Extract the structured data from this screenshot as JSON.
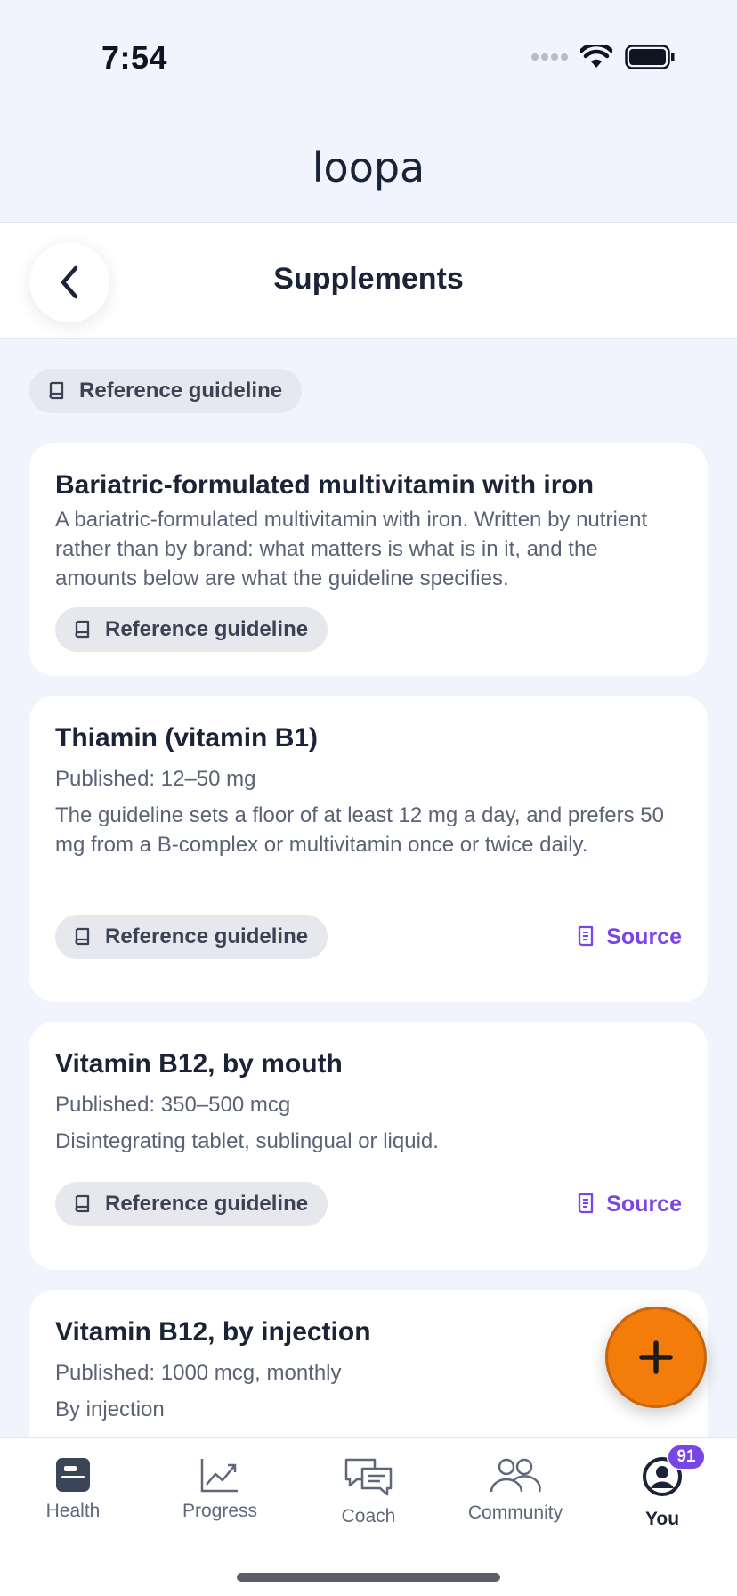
{
  "status": {
    "time": "7:54"
  },
  "app": {
    "logo": "loopa"
  },
  "header": {
    "title": "Supplements",
    "back_icon": "chevron-left-icon"
  },
  "filter_chip": {
    "label": "Reference guideline",
    "icon": "book-icon"
  },
  "cards": [
    {
      "title": "Bariatric-formulated multivitamin with iron",
      "description": "A bariatric-formulated multivitamin with iron. Written by nutrient rather than by brand: what matters is what is in it, and the amounts below are what the guideline specifies.",
      "chip": "Reference guideline"
    },
    {
      "title": "Thiamin (vitamin B1)",
      "meta": "Published: 12–50 mg",
      "description": "The guideline sets a floor of at least 12 mg a day, and prefers 50 mg from a B-complex or multivitamin once or twice daily.",
      "chip": "Reference guideline",
      "source": "Source"
    },
    {
      "title": "Vitamin B12, by mouth",
      "meta": "Published: 350–500 mcg",
      "description": "Disintegrating tablet, sublingual or liquid.",
      "chip": "Reference guideline",
      "source": "Source"
    },
    {
      "title": "Vitamin B12, by injection",
      "meta": "Published: 1000 mcg, monthly",
      "description": "By injection"
    }
  ],
  "fab": {
    "icon": "plus-icon"
  },
  "tabs": [
    {
      "label": "Health",
      "icon": "health-icon"
    },
    {
      "label": "Progress",
      "icon": "progress-chart-icon"
    },
    {
      "label": "Coach",
      "icon": "chat-icon"
    },
    {
      "label": "Community",
      "icon": "people-icon"
    },
    {
      "label": "You",
      "icon": "user-icon",
      "badge": "91",
      "active": true
    }
  ],
  "colors": {
    "accent": "#7a45e6",
    "fab": "#f47c0a",
    "background": "#f1f4fc"
  }
}
